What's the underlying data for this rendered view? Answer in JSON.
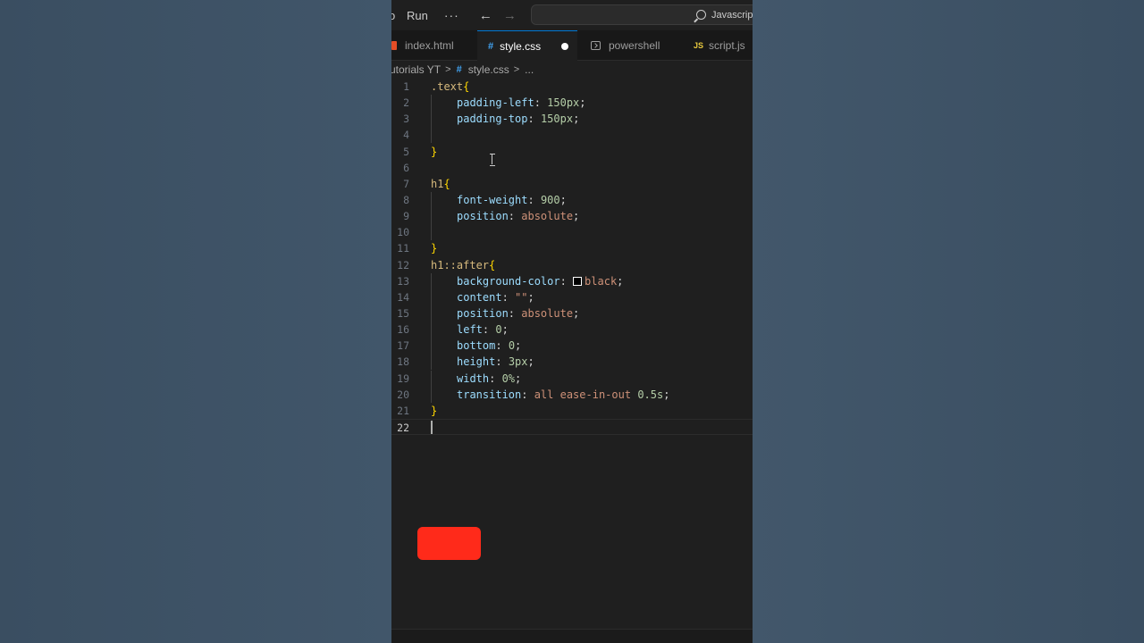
{
  "titlebar": {
    "menu_fragment": "o",
    "run_label": "Run",
    "more_label": "···",
    "back_arrow": "←",
    "forward_arrow": "→",
    "search_text": "Javascript"
  },
  "tabs": [
    {
      "label": "index.html",
      "icon": "html-file-icon",
      "active": false
    },
    {
      "label": "style.css",
      "icon": "css-hash-icon",
      "active": true,
      "modified": true
    },
    {
      "label": "powershell",
      "icon": "terminal-icon",
      "active": false
    },
    {
      "label": "script.js",
      "icon": "js-file-icon",
      "icon_text": "JS",
      "active": false
    }
  ],
  "breadcrumb": {
    "root": "utorials YT",
    "file": "style.css",
    "tail": "...",
    "separator": ">"
  },
  "code": {
    "line_numbers": [
      "1",
      "2",
      "3",
      "4",
      "5",
      "6",
      "7",
      "8",
      "9",
      "10",
      "11",
      "12",
      "13",
      "14",
      "15",
      "16",
      "17",
      "18",
      "19",
      "20",
      "21",
      "22"
    ],
    "current_line": 22,
    "l1_sel": ".text",
    "l1_brace": "{",
    "l2_prop": "padding-left",
    "l2_val": "150px",
    "l3_prop": "padding-top",
    "l3_val": "150px",
    "l5_brace": "}",
    "l7_sel": "h1",
    "l7_brace": "{",
    "l8_prop": "font-weight",
    "l8_val": "900",
    "l9_prop": "position",
    "l9_val": "absolute",
    "l11_brace": "}",
    "l12_sel": "h1::after",
    "l12_brace": "{",
    "l13_prop": "background-color",
    "l13_val": "black",
    "l14_prop": "content",
    "l14_val": "\"\"",
    "l15_prop": "position",
    "l15_val": "absolute",
    "l16_prop": "left",
    "l16_val": "0",
    "l17_prop": "bottom",
    "l17_val": "0",
    "l18_prop": "height",
    "l18_val": "3px",
    "l19_prop": "width",
    "l19_val": "0%",
    "l20_prop": "transition",
    "l20_val_kw": "all ease-in-out",
    "l20_val_num": "0.5s",
    "l21_brace": "}"
  },
  "colors": {
    "background": "#3e5163",
    "editor": "#1f1f1f",
    "selector": "#d7ba7d",
    "brace": "#ffd700",
    "property": "#9cdcfe",
    "number": "#b5cea8",
    "string_value": "#ce9178",
    "red_button": "#ff2a1a"
  }
}
